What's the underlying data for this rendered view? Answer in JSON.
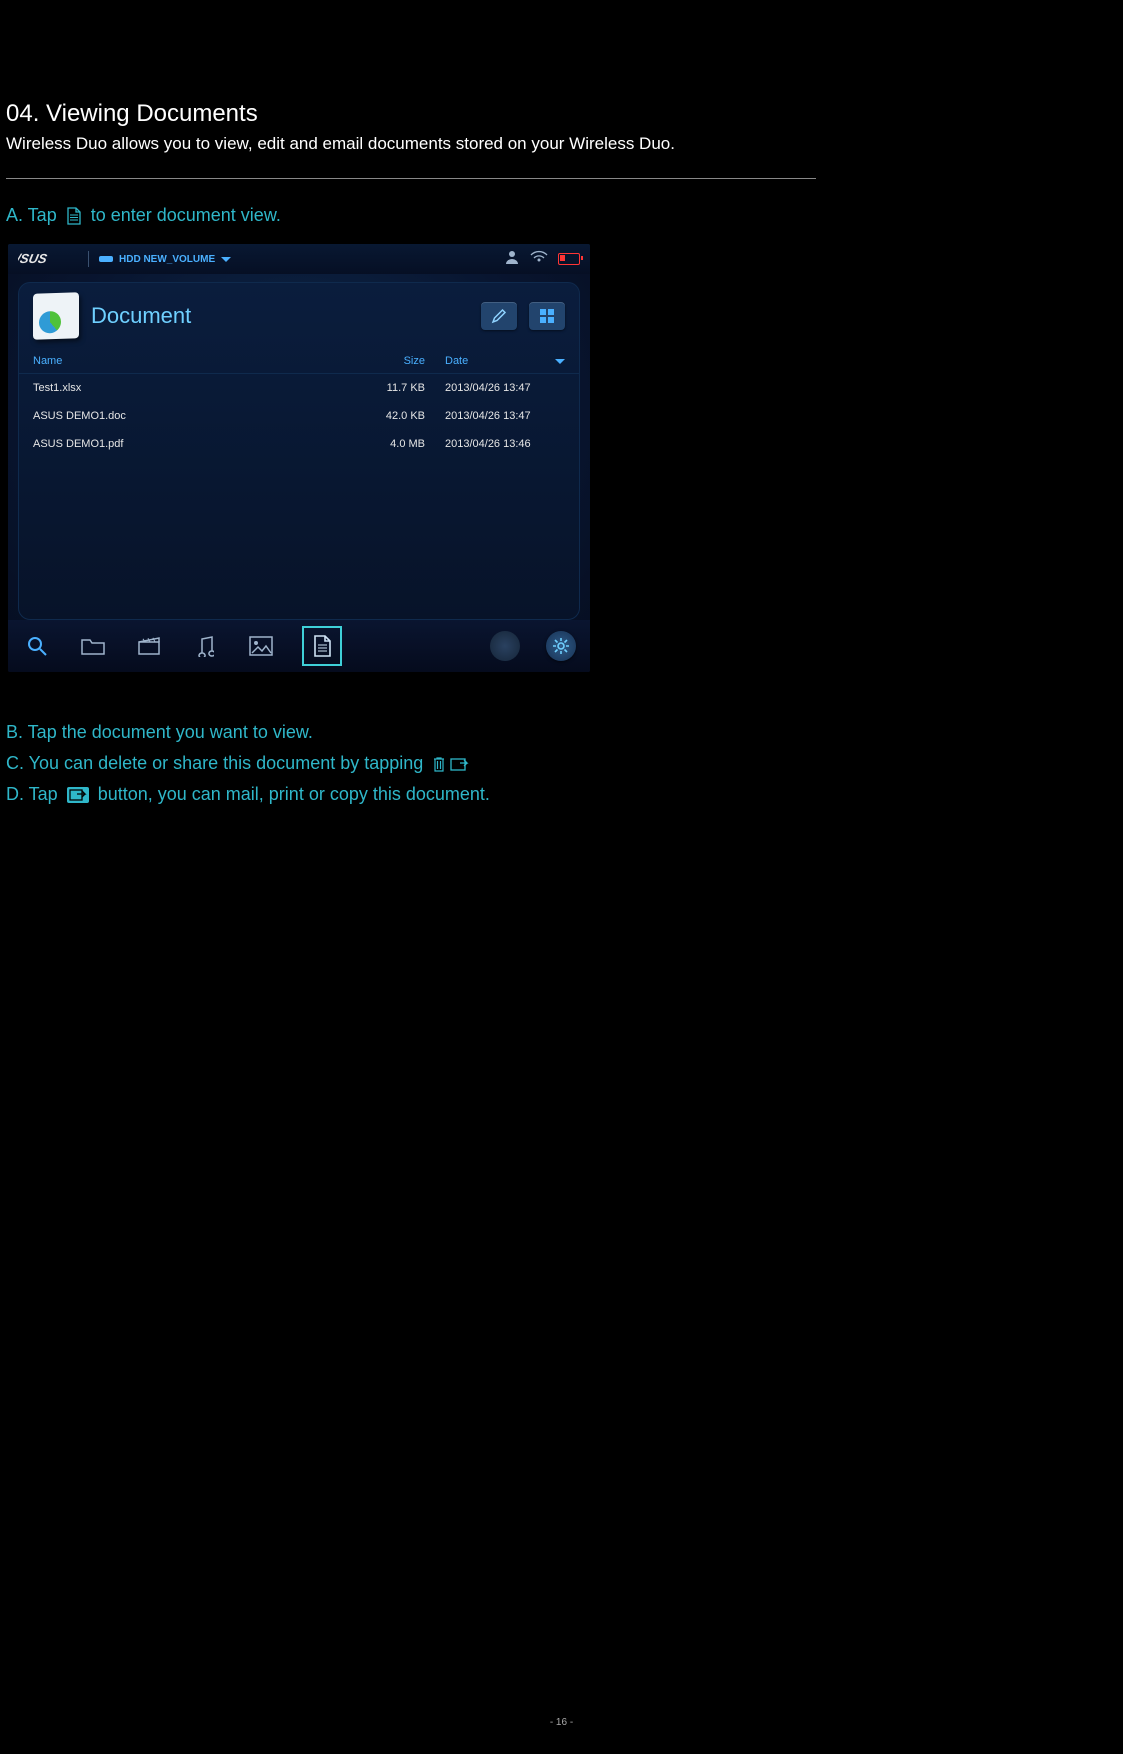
{
  "section": {
    "title": "04. Viewing Documents",
    "desc": "Wireless Duo allows you to view, edit and email documents stored on your Wireless Duo."
  },
  "steps": {
    "a_pre": "A. Tap ",
    "a_post": " to enter document view.",
    "b": "B. Tap the document you want to view.",
    "c_pre": "C. You can delete or share this document by tapping ",
    "d_pre": "D. Tap ",
    "d_post": " button, you can mail, print or copy this document."
  },
  "screenshot": {
    "volume_label": "HDD NEW_VOLUME",
    "panel_title": "Document",
    "columns": {
      "name": "Name",
      "size": "Size",
      "date": "Date"
    },
    "rows": [
      {
        "name": "Test1.xlsx",
        "size": "11.7 KB",
        "date": "2013/04/26 13:47"
      },
      {
        "name": "ASUS DEMO1.doc",
        "size": "42.0 KB",
        "date": "2013/04/26 13:47"
      },
      {
        "name": "ASUS DEMO1.pdf",
        "size": "4.0 MB",
        "date": "2013/04/26 13:46"
      }
    ]
  },
  "page_number": "- 16 -"
}
